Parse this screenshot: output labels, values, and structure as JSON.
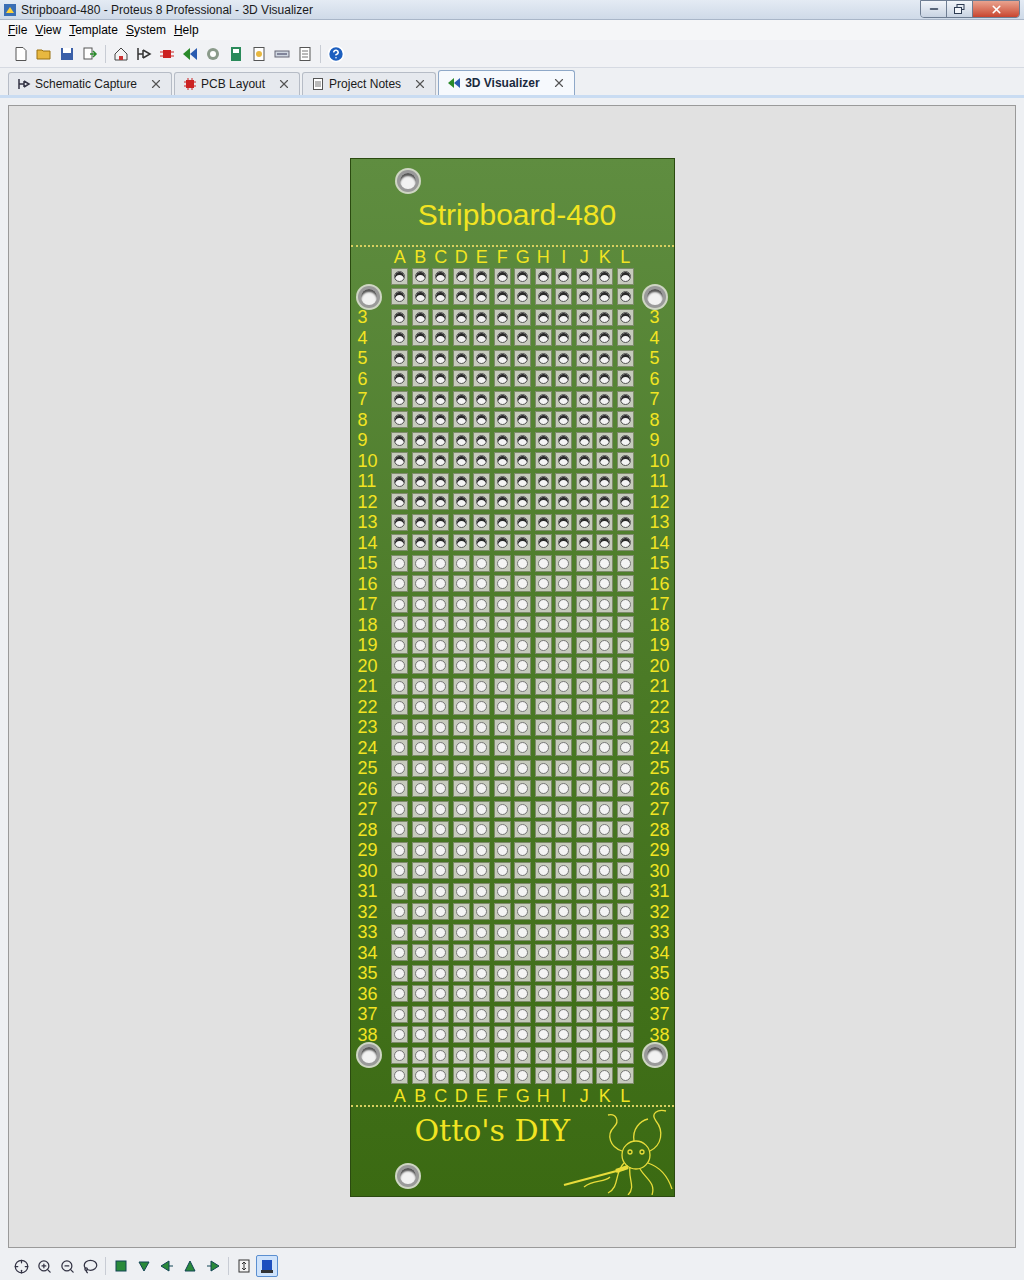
{
  "window": {
    "title": "Stripboard-480 - Proteus 8 Professional - 3D Visualizer"
  },
  "menu": [
    "File",
    "View",
    "Template",
    "System",
    "Help"
  ],
  "tabs": [
    {
      "label": "Schematic Capture",
      "selected": false
    },
    {
      "label": "PCB Layout",
      "selected": false
    },
    {
      "label": "Project Notes",
      "selected": false
    },
    {
      "label": "3D Visualizer",
      "selected": true
    }
  ],
  "board": {
    "title": "Stripboard-480",
    "columns": [
      "A",
      "B",
      "C",
      "D",
      "E",
      "F",
      "G",
      "H",
      "I",
      "J",
      "K",
      "L"
    ],
    "rows": [
      {
        "label": "",
        "mount_hole": false
      },
      {
        "label": "",
        "mount_hole": true
      },
      {
        "label": "3",
        "mount_hole": false
      },
      {
        "label": "4",
        "mount_hole": false
      },
      {
        "label": "5",
        "mount_hole": false
      },
      {
        "label": "6",
        "mount_hole": false
      },
      {
        "label": "7",
        "mount_hole": false
      },
      {
        "label": "8",
        "mount_hole": false
      },
      {
        "label": "9",
        "mount_hole": false
      },
      {
        "label": "10",
        "mount_hole": false
      },
      {
        "label": "11",
        "mount_hole": false
      },
      {
        "label": "12",
        "mount_hole": false
      },
      {
        "label": "13",
        "mount_hole": false
      },
      {
        "label": "14",
        "mount_hole": false
      },
      {
        "label": "15",
        "mount_hole": false
      },
      {
        "label": "16",
        "mount_hole": false
      },
      {
        "label": "17",
        "mount_hole": false
      },
      {
        "label": "18",
        "mount_hole": false
      },
      {
        "label": "19",
        "mount_hole": false
      },
      {
        "label": "20",
        "mount_hole": false
      },
      {
        "label": "21",
        "mount_hole": false
      },
      {
        "label": "22",
        "mount_hole": false
      },
      {
        "label": "23",
        "mount_hole": false
      },
      {
        "label": "24",
        "mount_hole": false
      },
      {
        "label": "25",
        "mount_hole": false
      },
      {
        "label": "26",
        "mount_hole": false
      },
      {
        "label": "27",
        "mount_hole": false
      },
      {
        "label": "28",
        "mount_hole": false
      },
      {
        "label": "29",
        "mount_hole": false
      },
      {
        "label": "30",
        "mount_hole": false
      },
      {
        "label": "31",
        "mount_hole": false
      },
      {
        "label": "32",
        "mount_hole": false
      },
      {
        "label": "33",
        "mount_hole": false
      },
      {
        "label": "34",
        "mount_hole": false
      },
      {
        "label": "35",
        "mount_hole": false
      },
      {
        "label": "36",
        "mount_hole": false
      },
      {
        "label": "37",
        "mount_hole": false
      },
      {
        "label": "38",
        "mount_hole": false
      },
      {
        "label": "",
        "mount_hole": true
      },
      {
        "label": "",
        "mount_hole": false
      }
    ],
    "footer": "Otto's DIY"
  },
  "view_toggles": [
    {
      "selected": false
    },
    {
      "selected": true
    }
  ]
}
